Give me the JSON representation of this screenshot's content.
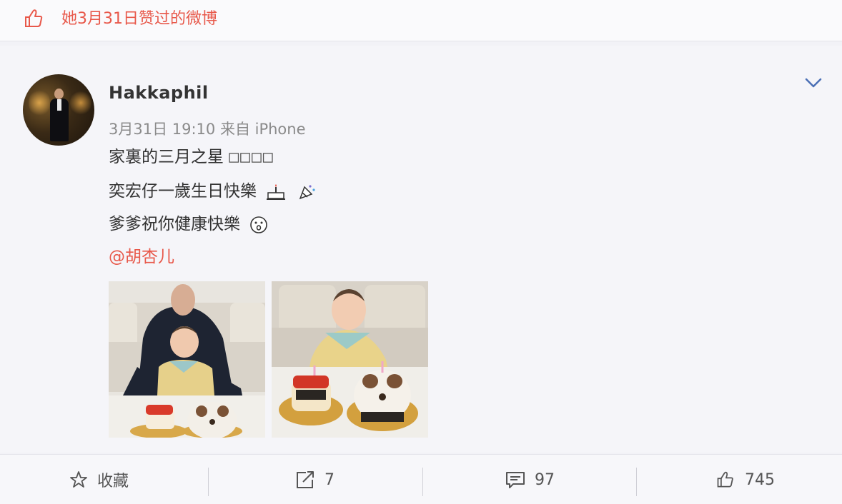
{
  "banner": {
    "icon": "thumbs-up-icon",
    "text": "她3月31日赞过的微博",
    "color": "#e8584a"
  },
  "post": {
    "username": "Hakkaphil",
    "meta": "3月31日 19:10 来自 iPhone",
    "lines": {
      "line1": "家裏的三月之星",
      "line1_boxes": "□□□□",
      "line2": "奕宏仔一歲生日快樂",
      "line3": "爹爹祝你健康快樂",
      "mention": "@胡杏儿"
    },
    "images": [
      "photo-father-baby-cakes",
      "photo-baby-cakes"
    ]
  },
  "footer": {
    "favorite_label": "收藏",
    "repost_count": "7",
    "comment_count": "97",
    "like_count": "745"
  }
}
